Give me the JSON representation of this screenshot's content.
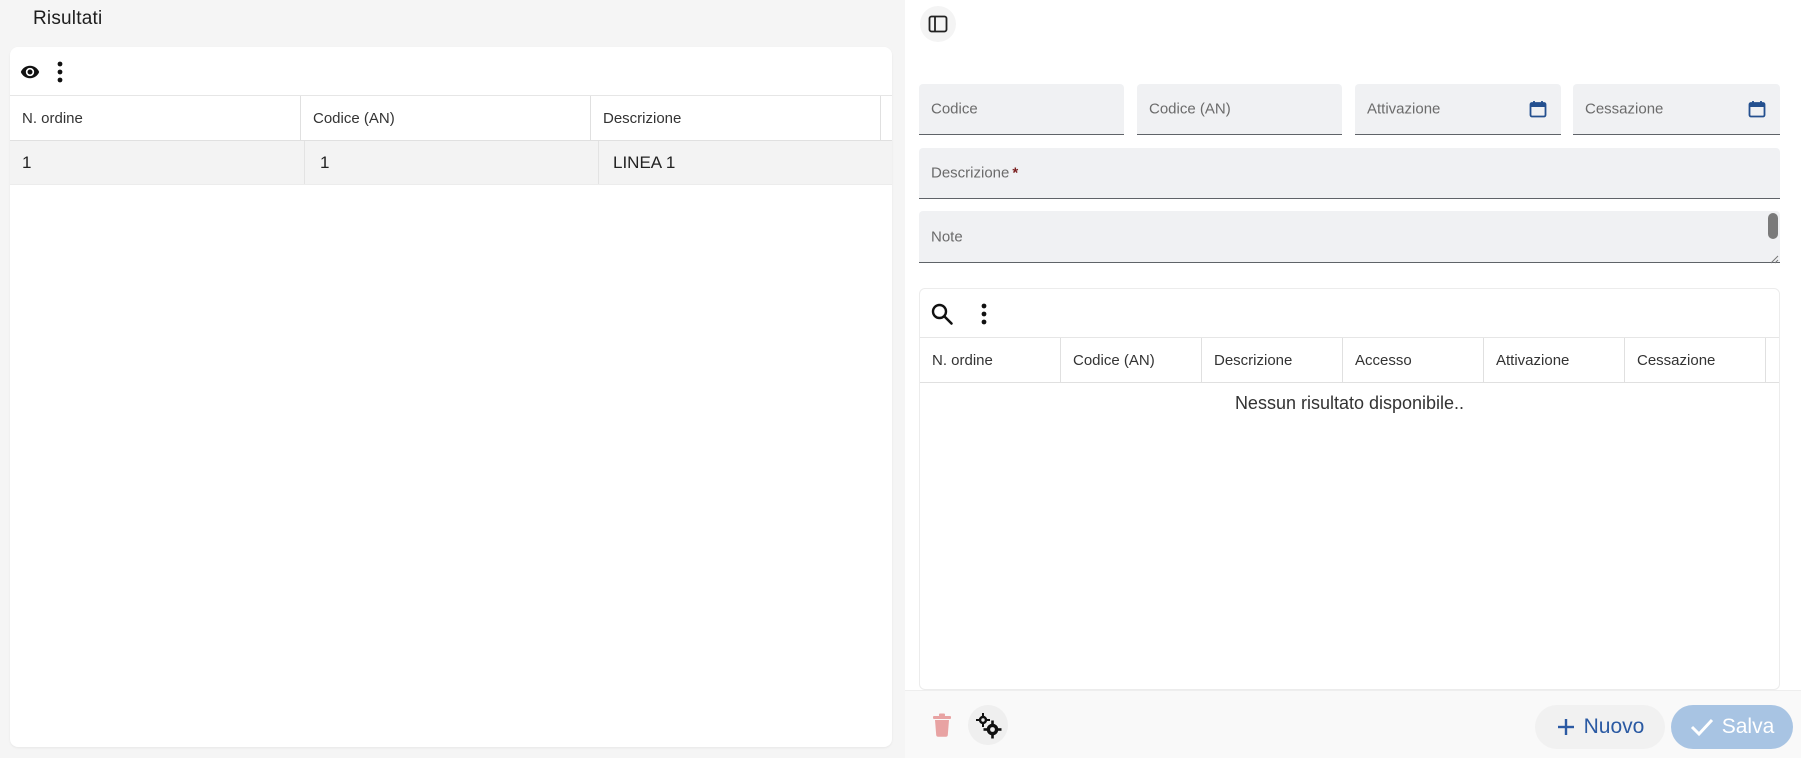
{
  "results_panel": {
    "title": "Risultati",
    "toolbar": {
      "visibility_icon": "eye-icon",
      "menu_icon": "more-vert-icon"
    },
    "columns": [
      "N. ordine",
      "Codice (AN)",
      "Descrizione"
    ],
    "rows": [
      {
        "n_ordine": "1",
        "codice_an": "1",
        "descrizione": "LINEA 1"
      }
    ]
  },
  "detail_panel": {
    "toggle_icon": "sidebar-panel-icon",
    "fields": {
      "codice": {
        "label": "Codice"
      },
      "codice_an": {
        "label": "Codice (AN)"
      },
      "attivazione": {
        "label": "Attivazione",
        "icon": "calendar-icon"
      },
      "cessazione": {
        "label": "Cessazione",
        "icon": "calendar-icon"
      },
      "descrizione": {
        "label": "Descrizione",
        "required_mark": "*"
      },
      "note": {
        "label": "Note"
      }
    },
    "sub_table": {
      "toolbar": {
        "search_icon": "search-icon",
        "menu_icon": "more-vert-icon"
      },
      "columns": [
        "N. ordine",
        "Codice (AN)",
        "Descrizione",
        "Accesso",
        "Attivazione",
        "Cessazione"
      ],
      "empty_message": "Nessun risultato disponibile.."
    },
    "footer": {
      "delete_icon": "trash-icon",
      "settings_icon": "gears-icon",
      "new_label": "Nuovo",
      "save_label": "Salva"
    }
  },
  "colors": {
    "accent": "#2b5aa3",
    "save_disabled_bg": "#a8c4e3",
    "delete_disabled": "#e8a3a3",
    "required_mark": "#7a1f1f"
  }
}
